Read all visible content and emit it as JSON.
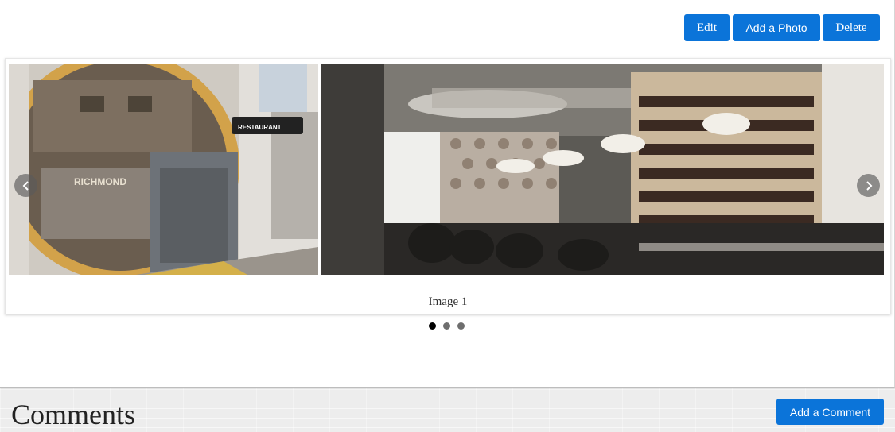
{
  "toolbar": {
    "edit_label": "Edit",
    "add_photo_label": "Add a Photo",
    "delete_label": "Delete"
  },
  "carousel": {
    "caption": "Image 1",
    "slide_count": 3,
    "active_slide": 1,
    "prev_icon": "chevron-left-icon",
    "next_icon": "chevron-right-icon"
  },
  "comments": {
    "title": "Comments",
    "add_label": "Add a Comment"
  },
  "colors": {
    "button": "#0b74d9",
    "dot_active": "#000000",
    "dot_inactive": "#6e6e6e"
  }
}
